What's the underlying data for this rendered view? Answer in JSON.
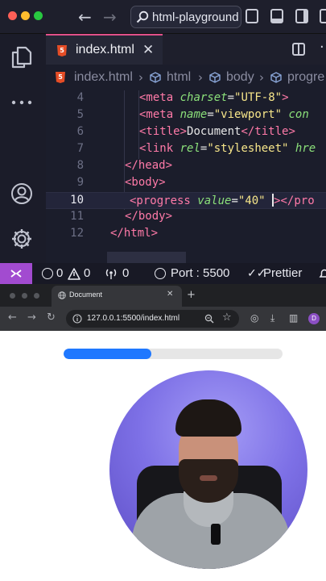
{
  "vscode": {
    "command_center": "html-playground",
    "tab": {
      "label": "index.html"
    },
    "breadcrumb": [
      "index.html",
      "html",
      "body",
      "progre"
    ],
    "lines": [
      {
        "n": "4",
        "indent": 2,
        "cur": false
      },
      {
        "n": "5",
        "indent": 2,
        "cur": false
      },
      {
        "n": "6",
        "indent": 2,
        "cur": false
      },
      {
        "n": "7",
        "indent": 2,
        "cur": false
      },
      {
        "n": "8",
        "indent": 1,
        "cur": false
      },
      {
        "n": "9",
        "indent": 1,
        "cur": false
      },
      {
        "n": "10",
        "indent": 2,
        "cur": true
      },
      {
        "n": "11",
        "indent": 1,
        "cur": false
      },
      {
        "n": "12",
        "indent": 0,
        "cur": false
      }
    ],
    "code": {
      "l4": {
        "tag": "<meta",
        "attr": "charset",
        "eq": "=",
        "val": "\"UTF-8\"",
        "end": ">"
      },
      "l5": {
        "tag": "<meta",
        "attr": "name",
        "eq": "=",
        "val": "\"viewport\"",
        "attr2": "con"
      },
      "l6": {
        "tag_open": "<title>",
        "text": "Document",
        "tag_close": "</title>"
      },
      "l7": {
        "tag": "<link",
        "attr": "rel",
        "eq": "=",
        "val": "\"stylesheet\"",
        "attr2": "hre"
      },
      "l8": {
        "tag": "</head>"
      },
      "l9": {
        "tag": "<body>"
      },
      "l10": {
        "tag": "<progress",
        "attr": "value",
        "eq": "=",
        "val": "\"40\"",
        "after": ">",
        "close": "</pro"
      },
      "l11": {
        "tag": "</body>"
      },
      "l12": {
        "tag": "</html>"
      }
    },
    "status": {
      "errors": "0",
      "warnings": "0",
      "ports": "0",
      "port_label": "Port : 5500",
      "prettier": "Prettier"
    }
  },
  "browser": {
    "tab_title": "Document",
    "new_tab": "+",
    "url": "127.0.0.1:5500/index.html",
    "profile_initial": "D",
    "progress": {
      "value": 40,
      "max": 100
    }
  },
  "colors": {
    "accent_tab": "#e0508a",
    "remote": "#a24bd0",
    "progress_fill": "#1f78ff"
  }
}
